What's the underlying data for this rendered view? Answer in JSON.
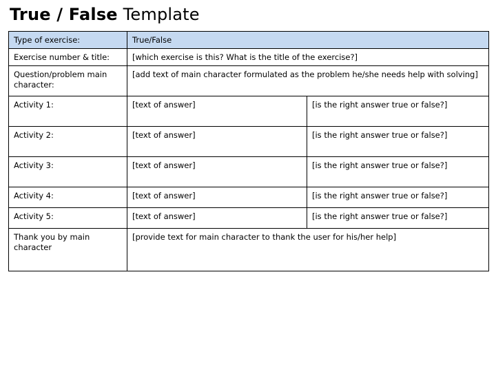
{
  "slide": {
    "title_bold": "True / False",
    "title_regular": " Template",
    "header_fill_color": "#c5d9f1",
    "border_color": "#000000",
    "text_color": "#000000"
  },
  "table": {
    "rows": [
      {
        "label": "Type of exercise:",
        "middle": "True/False",
        "right": "",
        "spans_middle": true,
        "is_header": true
      },
      {
        "label": "Exercise number & title:",
        "middle": "[which exercise is this? What is the title of the exercise?]",
        "right": "",
        "spans_middle": true,
        "is_header": false
      },
      {
        "label": "Question/problem main character:",
        "middle": "[add text of main character formulated as the problem he/she needs help with solving]",
        "right": "",
        "spans_middle": true,
        "is_header": false
      },
      {
        "label": "Activity 1:",
        "middle": "[text of answer]",
        "right": "[is the right answer true or false?]",
        "spans_middle": false,
        "is_header": false
      },
      {
        "label": "Activity 2:",
        "middle": "[text of answer]",
        "right": "[is the right answer true or false?]",
        "spans_middle": false,
        "is_header": false
      },
      {
        "label": "Activity 3:",
        "middle": "[text of answer]",
        "right": "[is the right answer true or false?]",
        "spans_middle": false,
        "is_header": false
      },
      {
        "label": "Activity 4:",
        "middle": "[text of answer]",
        "right": "[is the right answer true or false?]",
        "spans_middle": false,
        "is_header": false
      },
      {
        "label": "Activity 5:",
        "middle": "[text of answer]",
        "right": "[is the right answer true or false?]",
        "spans_middle": false,
        "is_header": false
      },
      {
        "label": "Thank you by main character",
        "middle": "[provide text for main character to thank the user for his/her help]",
        "right": "",
        "spans_middle": true,
        "is_header": false
      }
    ]
  }
}
